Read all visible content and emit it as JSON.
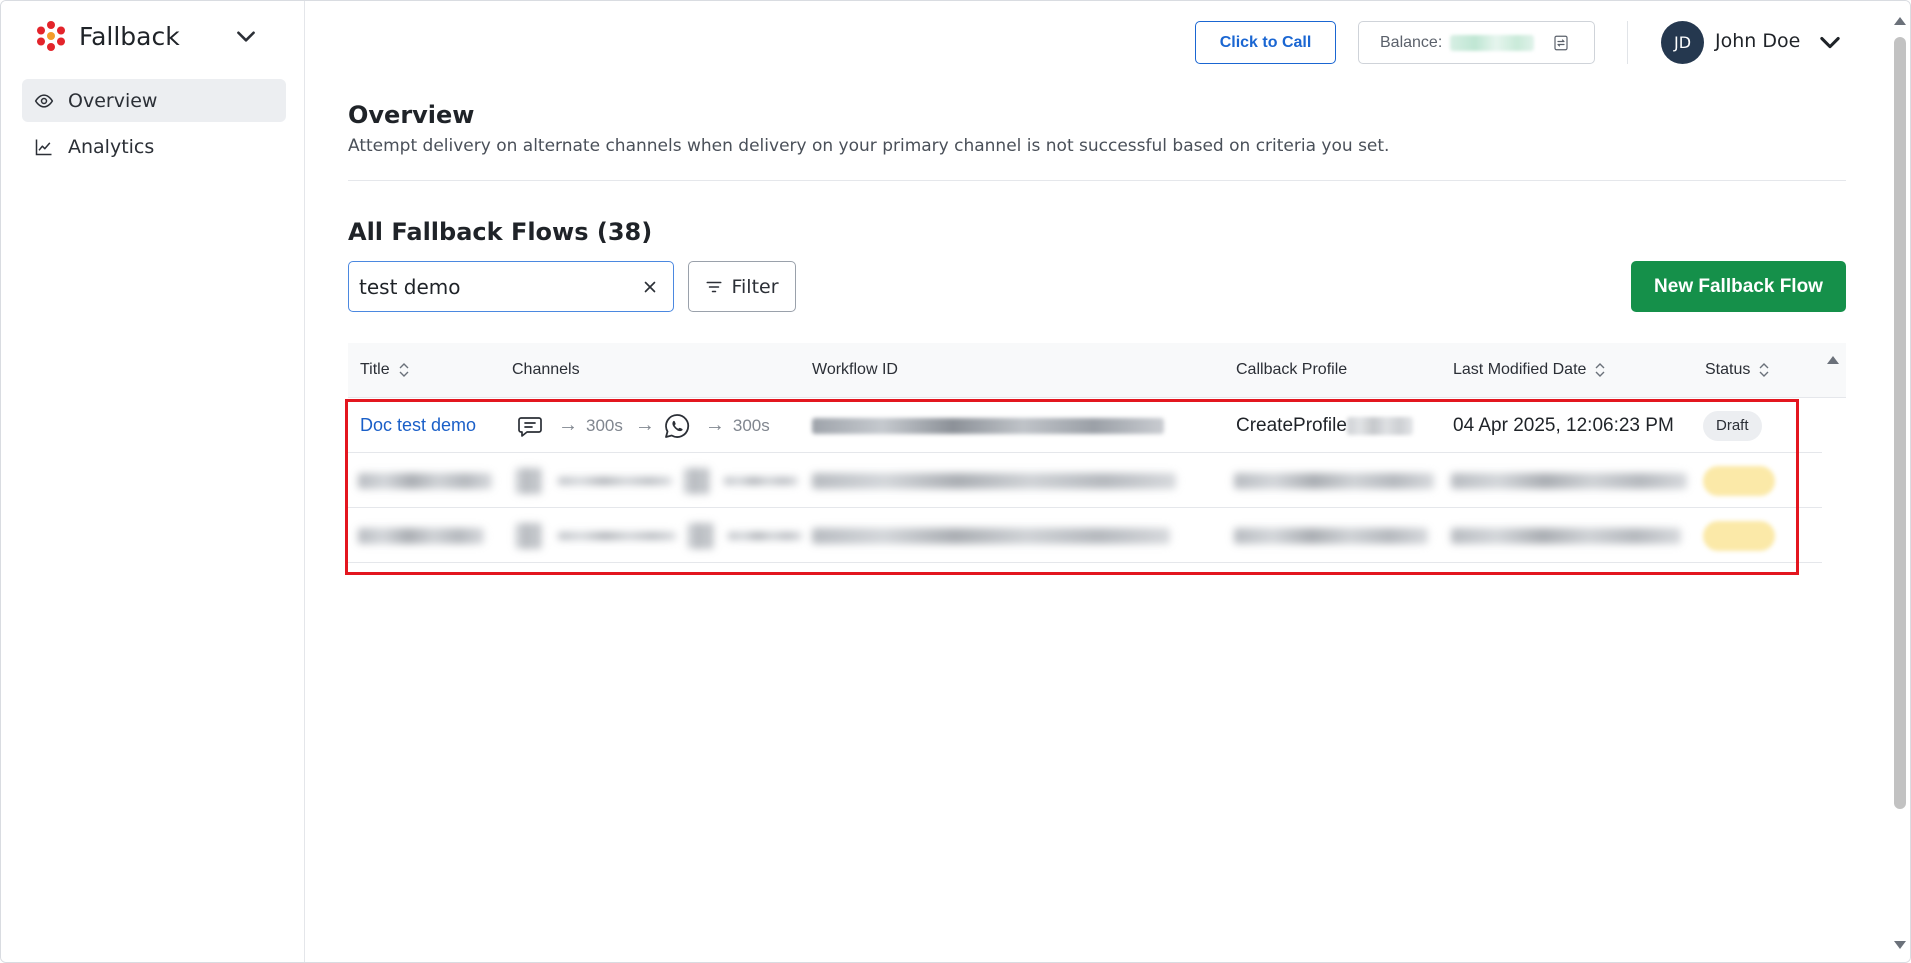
{
  "app": {
    "name": "Fallback",
    "brand_color": "#e3242b"
  },
  "sidebar": {
    "items": [
      {
        "label": "Overview",
        "icon": "eye-icon",
        "active": true
      },
      {
        "label": "Analytics",
        "icon": "line-chart-icon",
        "active": false
      }
    ]
  },
  "header": {
    "click_to_call_label": "Click to Call",
    "balance_label": "Balance:",
    "user_initials": "JD",
    "user_name": "John Doe"
  },
  "page": {
    "title": "Overview",
    "description": "Attempt delivery on alternate channels when delivery on your primary channel is not successful based on criteria you set.",
    "section_title": "All Fallback Flows (38)"
  },
  "toolbar": {
    "search_value": "test demo",
    "filter_label": "Filter",
    "new_flow_label": "New Fallback Flow"
  },
  "table": {
    "columns": [
      "Title",
      "Channels",
      "Workflow ID",
      "Callback Profile",
      "Last Modified Date",
      "Status"
    ],
    "rows": [
      {
        "title": "Doc test demo",
        "channels": [
          {
            "icon": "sms-chat-icon"
          },
          {
            "delay": "300s",
            "icon": "whatsapp-icon"
          },
          {
            "delay": "300s"
          }
        ],
        "callback_profile": "CreateProfile",
        "last_modified": "04 Apr 2025, 12:06:23 PM",
        "status": "Draft"
      }
    ]
  },
  "colors": {
    "accent_blue": "#1a66d2",
    "primary_green": "#15904a",
    "highlight_red": "#e3161f",
    "avatar_bg": "#25384f"
  }
}
